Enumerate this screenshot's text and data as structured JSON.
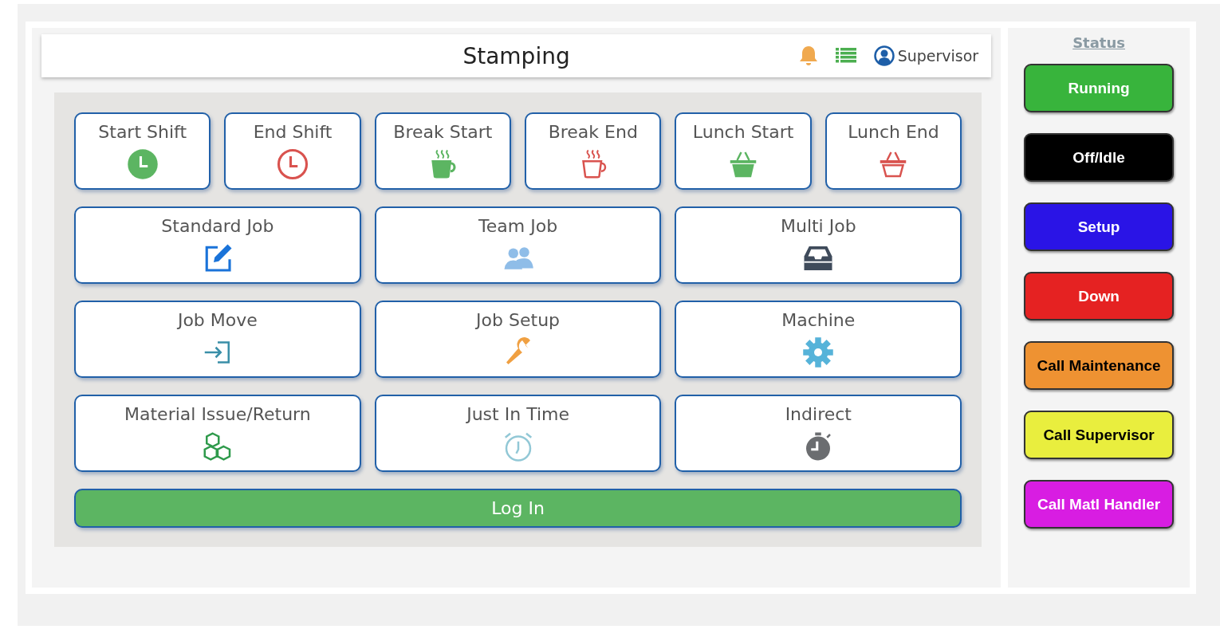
{
  "header": {
    "title": "Stamping",
    "user": "Supervisor"
  },
  "tiles": [
    {
      "label": "Start Shift"
    },
    {
      "label": "End Shift"
    },
    {
      "label": "Break Start"
    },
    {
      "label": "Break End"
    },
    {
      "label": "Lunch Start"
    },
    {
      "label": "Lunch End"
    },
    {
      "label": "Standard Job"
    },
    {
      "label": "Team Job"
    },
    {
      "label": "Multi Job"
    },
    {
      "label": "Job Move"
    },
    {
      "label": "Job Setup"
    },
    {
      "label": "Machine"
    },
    {
      "label": "Material Issue/Return"
    },
    {
      "label": "Just In Time"
    },
    {
      "label": "Indirect"
    }
  ],
  "login_button": "Log In",
  "status": {
    "title": "Status",
    "buttons": [
      {
        "label": "Running",
        "color": "#38b43c"
      },
      {
        "label": "Off/Idle",
        "color": "#000000"
      },
      {
        "label": "Setup",
        "color": "#2a14e6"
      },
      {
        "label": "Down",
        "color": "#e52222"
      },
      {
        "label": "Call Maintenance",
        "color": "#ee9232"
      },
      {
        "label": "Call Supervisor",
        "color": "#e9ee3e"
      },
      {
        "label": "Call Matl Handler",
        "color": "#d81de2"
      }
    ]
  }
}
